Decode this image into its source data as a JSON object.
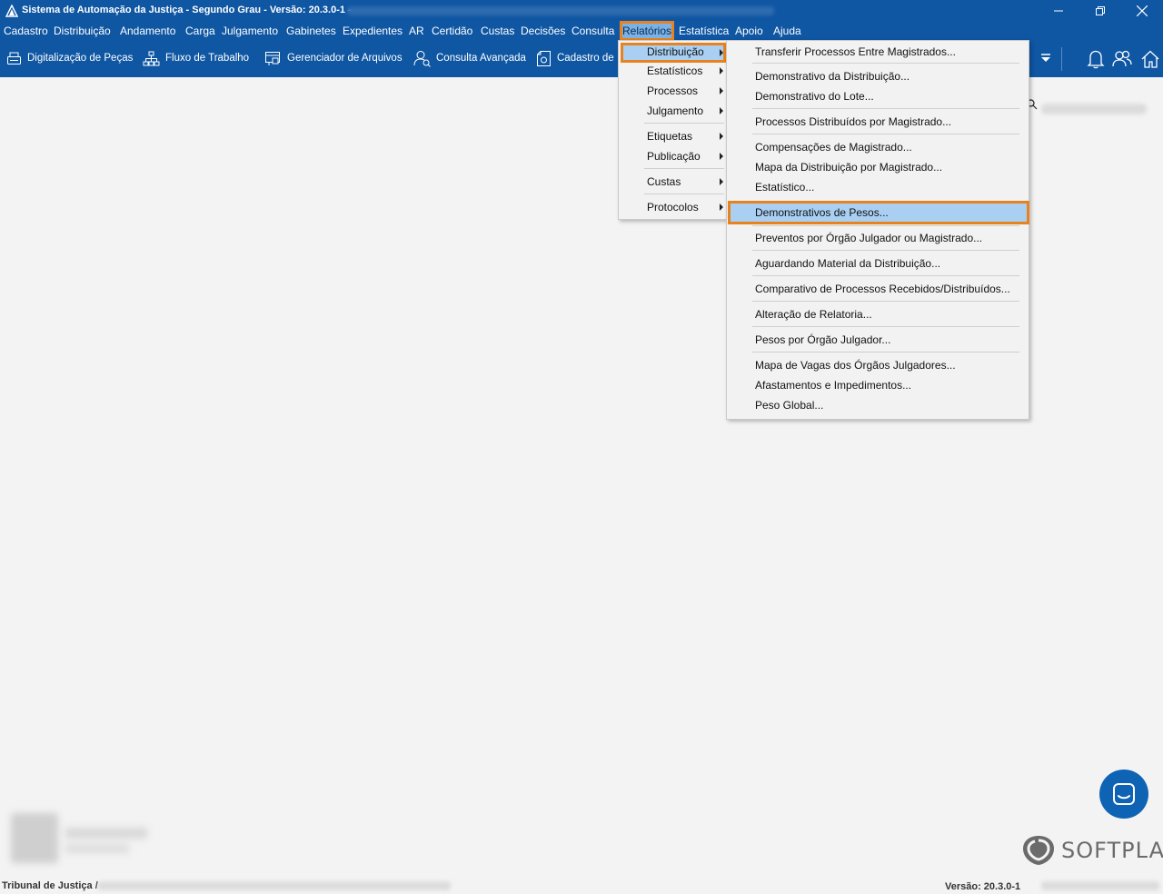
{
  "window": {
    "title": "Sistema de Automação da Justiça - Segundo Grau - Versão: 20.3.0-1 -"
  },
  "menubar": {
    "items": [
      "Cadastro",
      "Distribuição",
      "Andamento",
      "Carga",
      "Julgamento",
      "Gabinetes",
      "Expedientes",
      "AR",
      "Certidão",
      "Custas",
      "Decisões",
      "Consulta",
      "Relatórios",
      "Estatística",
      "Apoio",
      "Ajuda"
    ],
    "active": "Relatórios"
  },
  "toolbar": {
    "buttons": [
      {
        "label": "Digitalização de Peças",
        "icon": "scanner-icon"
      },
      {
        "label": "Fluxo de Trabalho",
        "icon": "workflow-icon"
      },
      {
        "label": "Gerenciador de Arquivos",
        "icon": "file-manager-icon"
      },
      {
        "label": "Consulta Avançada",
        "icon": "user-search-icon"
      },
      {
        "label": "Cadastro de",
        "icon": "document-icon"
      }
    ],
    "right_icons": [
      "dropdown-arrow-icon",
      "bell-icon",
      "users-icon",
      "home-icon"
    ]
  },
  "relatorios_menu": {
    "items": [
      "Distribuição",
      "Estatísticos",
      "Processos",
      "Julgamento",
      "Etiquetas",
      "Publicação",
      "Custas",
      "Protocolos"
    ],
    "highlighted": "Distribuição"
  },
  "distribuicao_submenu": {
    "items": [
      "Transferir Processos Entre Magistrados...",
      "Demonstrativo da Distribuição...",
      "Demonstrativo do Lote...",
      "Processos Distribuídos por Magistrado...",
      "Compensações de Magistrado...",
      "Mapa da Distribuição por Magistrado...",
      "Estatístico...",
      "Demonstrativos de Pesos...",
      "Preventos por Órgão Julgador ou Magistrado...",
      "Aguardando Material da Distribuição...",
      "Comparativo de Processos Recebidos/Distribuídos...",
      "Alteração de Relatoria...",
      "Pesos por Órgão Julgador...",
      "Mapa de Vagas dos Órgãos Julgadores...",
      "Afastamentos e Impedimentos...",
      "Peso Global..."
    ],
    "highlighted": "Demonstrativos de Pesos..."
  },
  "branding": {
    "company": "SOFTPLAN"
  },
  "statusbar": {
    "left": "Tribunal de Justiça /",
    "version": "Versão: 20.3.0-1"
  },
  "colors": {
    "header_blue": "#0f56a3",
    "highlight_orange": "#e8821e",
    "selection_blue": "#a9d0f3"
  }
}
